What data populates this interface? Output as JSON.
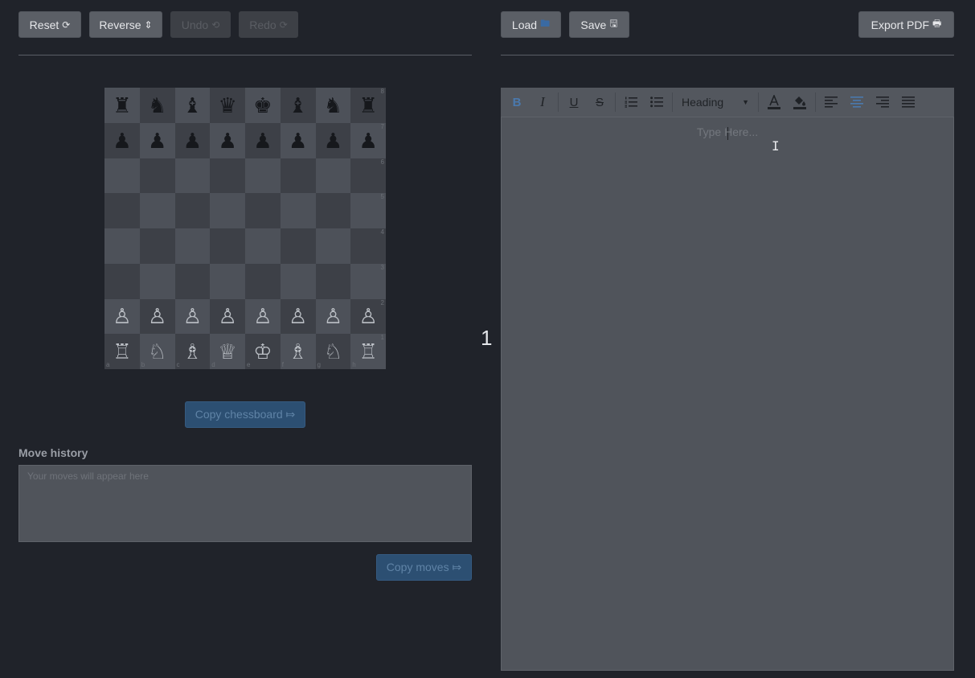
{
  "left_toolbar": {
    "reset": "Reset",
    "reset_icon": "⟳",
    "reverse": "Reverse",
    "reverse_icon": "⇕",
    "undo": "Undo",
    "undo_icon": "⟲",
    "redo": "Redo",
    "redo_icon": "⟳"
  },
  "right_toolbar": {
    "load": "Load",
    "load_icon": "🖿",
    "save": "Save",
    "save_icon": "🖫",
    "export": "Export PDF",
    "export_icon": "🖶"
  },
  "board": {
    "ranks": [
      "8",
      "7",
      "6",
      "5",
      "4",
      "3",
      "2",
      "1"
    ],
    "files": [
      "a",
      "b",
      "c",
      "d",
      "e",
      "f",
      "g",
      "h"
    ],
    "rows": [
      [
        "♜",
        "♞",
        "♝",
        "♛",
        "♚",
        "♝",
        "♞",
        "♜"
      ],
      [
        "♟",
        "♟",
        "♟",
        "♟",
        "♟",
        "♟",
        "♟",
        "♟"
      ],
      [
        "",
        "",
        "",
        "",
        "",
        "",
        "",
        ""
      ],
      [
        "",
        "",
        "",
        "",
        "",
        "",
        "",
        ""
      ],
      [
        "",
        "",
        "",
        "",
        "",
        "",
        "",
        ""
      ],
      [
        "",
        "",
        "",
        "",
        "",
        "",
        "",
        ""
      ],
      [
        "♙",
        "♙",
        "♙",
        "♙",
        "♙",
        "♙",
        "♙",
        "♙"
      ],
      [
        "♖",
        "♘",
        "♗",
        "♕",
        "♔",
        "♗",
        "♘",
        "♖"
      ]
    ]
  },
  "copy_chessboard": "Copy chessboard ⤇",
  "move_history": {
    "label": "Move history",
    "placeholder": "Your moves will appear here",
    "copy_button": "Copy moves ⤇"
  },
  "page_number": "1",
  "editor": {
    "heading": "Heading",
    "placeholder": "Type Here...",
    "colors": {
      "active": "#4a79ad"
    }
  }
}
